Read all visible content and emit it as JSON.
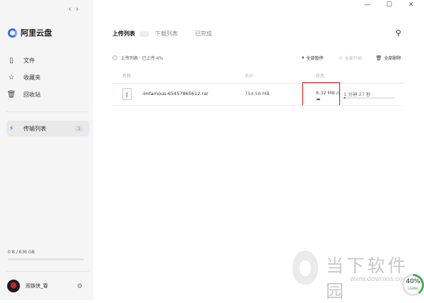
{
  "window": {
    "minimize_icon": "minimize-icon",
    "maximize_icon": "maximize-icon",
    "close_icon": "close-icon"
  },
  "sidebar": {
    "brand": "阿里云盘",
    "items": [
      {
        "label": "文件",
        "icon": "document-icon"
      },
      {
        "label": "收藏夹",
        "icon": "star-icon"
      },
      {
        "label": "回收站",
        "icon": "trash-icon"
      }
    ],
    "transfer": {
      "label": "传输列表",
      "count": "1"
    },
    "storage": {
      "text": "0 B / 636 GB",
      "used_fraction": 0.0
    },
    "user": {
      "name": "觊铢侠_春"
    }
  },
  "tabs": [
    {
      "label": "上传列表",
      "active": true
    },
    {
      "label": "下载列表",
      "active": false
    },
    {
      "label": "已完成",
      "active": false
    }
  ],
  "summary": "上传列表 · 已上传 4%",
  "actions": {
    "pause_all": "全部暂停",
    "start_all": "全部开始",
    "delete_all": "全部删除"
  },
  "table": {
    "headers": {
      "name": "名称",
      "size": "大小",
      "status": "状态"
    },
    "rows": [
      {
        "name": "-imfamous-65457865612.rar",
        "size": "754.56 MB",
        "speed": "8.32 MB /s",
        "remaining": "1 分钟 27 秒",
        "progress": 0.04
      }
    ]
  },
  "watermark": {
    "cn": "当下软件园",
    "url": "www.downxia.com"
  },
  "speed_widget": {
    "percent": "40%",
    "speed": "1.64M/s",
    "fraction": 0.4
  },
  "colors": {
    "accent": "#3a6cf4",
    "highlight_box": "#d60f17",
    "ring": "#3cb44b"
  }
}
